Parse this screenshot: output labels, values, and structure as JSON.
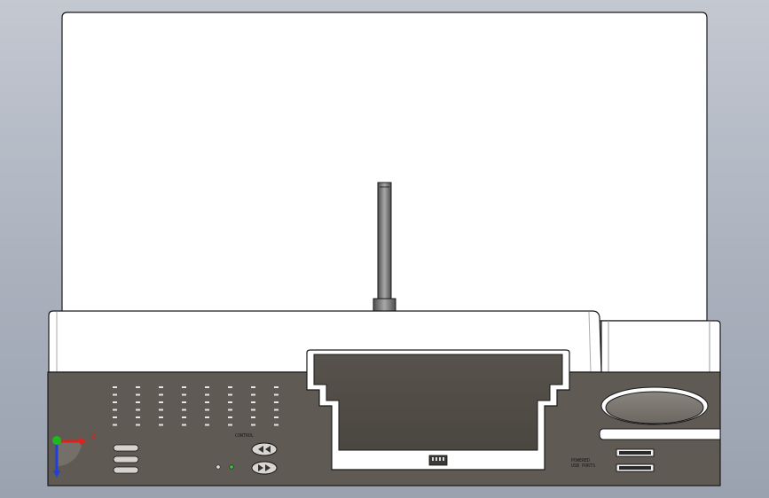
{
  "viewport": {
    "background_top": "#c3c8d1",
    "background_bottom": "#9aa2b0",
    "model_face_color": "#ffffff",
    "base_dark_color": "#5f5a53"
  },
  "model": {
    "labels": {
      "top_right_lines": [
        "POWERED",
        "USB PORTS"
      ],
      "lower_left_label": "CONTROL"
    },
    "grid": {
      "rows": 6,
      "cols": 8
    }
  },
  "triad": {
    "x_label": "X",
    "y_label": "Y",
    "x_color": "#e0201c",
    "y_color": "#1db91d",
    "z_color": "#1f3fe0"
  }
}
